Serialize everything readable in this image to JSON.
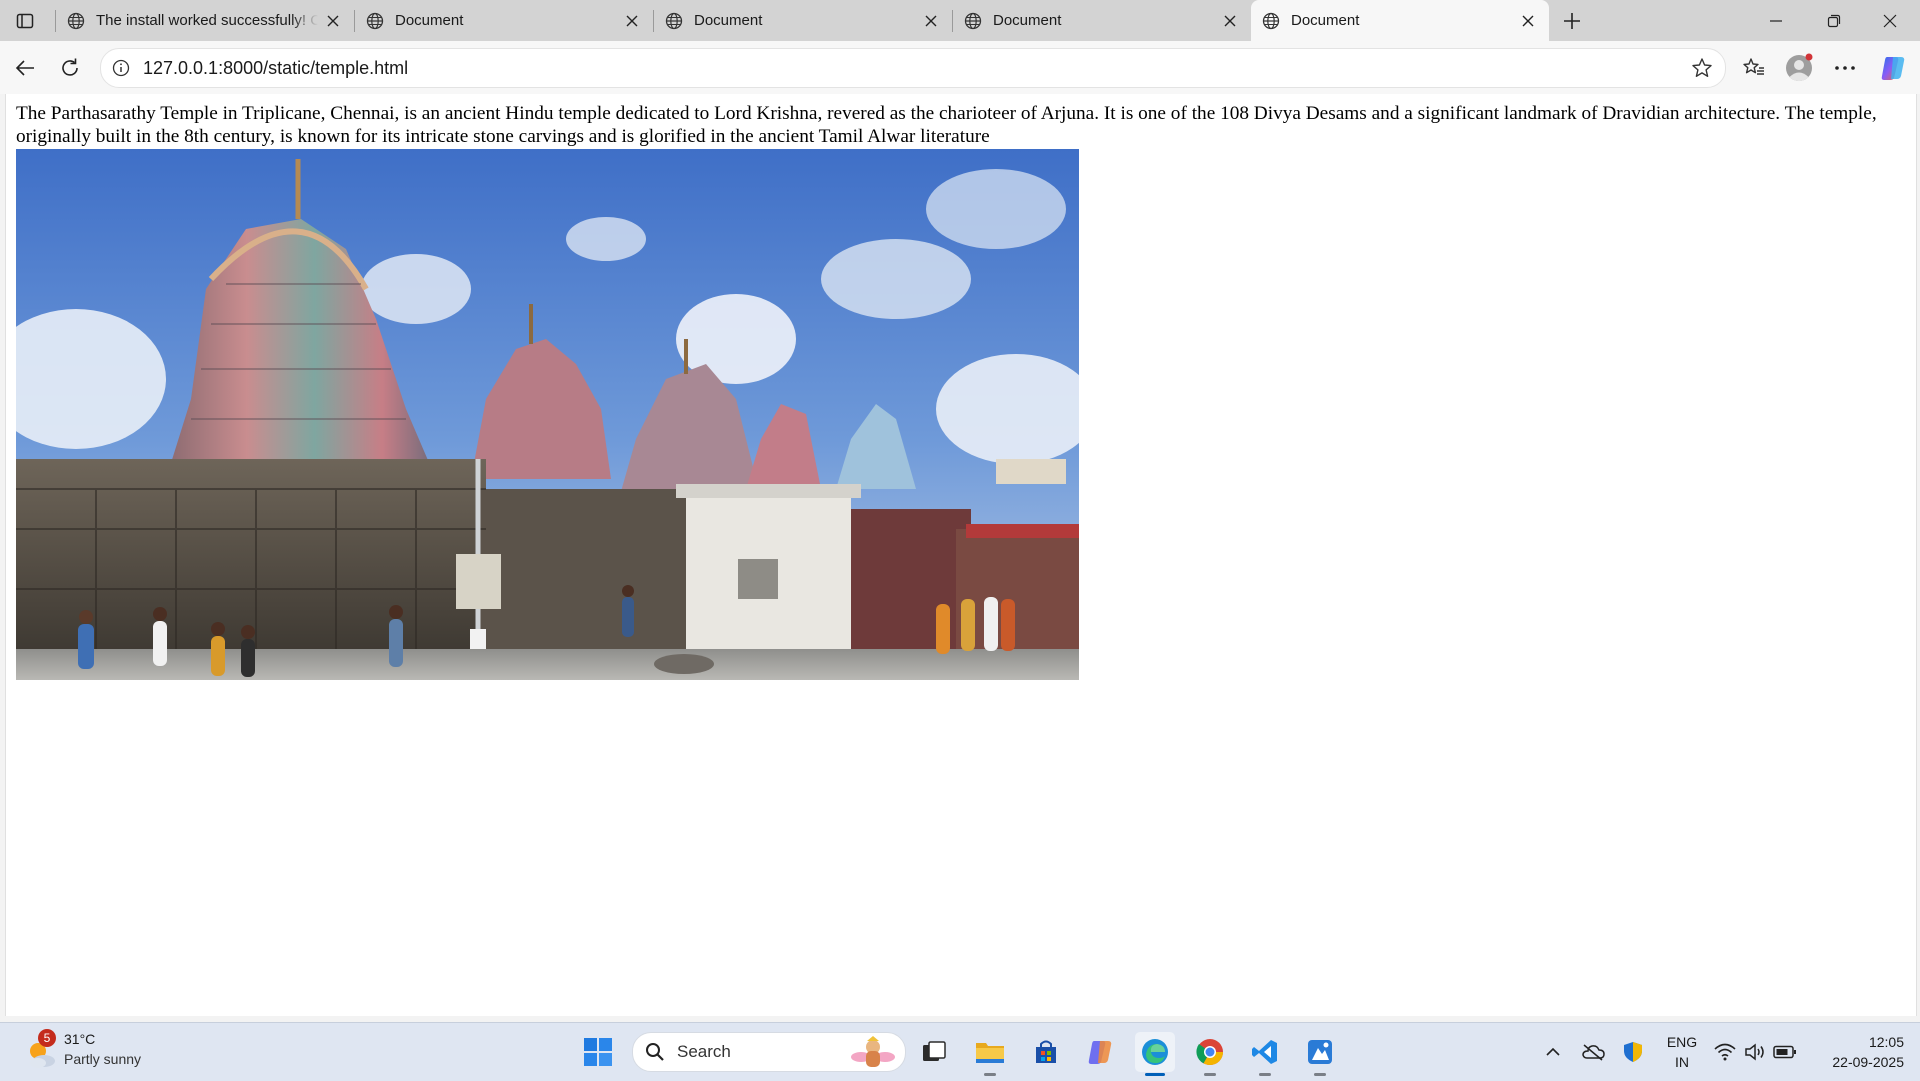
{
  "browser": {
    "tabs": [
      {
        "title": "The install worked successfully! Congratulations!",
        "active": false,
        "icon": "globe-icon"
      },
      {
        "title": "Document",
        "active": false,
        "icon": "globe-icon"
      },
      {
        "title": "Document",
        "active": false,
        "icon": "globe-icon"
      },
      {
        "title": "Document",
        "active": false,
        "icon": "globe-icon"
      },
      {
        "title": "Document",
        "active": true,
        "icon": "globe-icon"
      }
    ],
    "url": "127.0.0.1:8000/static/temple.html"
  },
  "page": {
    "paragraph": "The Parthasarathy Temple in Triplicane, Chennai, is an ancient Hindu temple dedicated to Lord Krishna, revered as the charioteer of Arjuna. It is one of the 108 Divya Desams and a significant landmark of Dravidian architecture. The temple, originally built in the 8th century, is known for its intricate stone carvings and is glorified in the ancient Tamil Alwar literature",
    "image_alt": "temple photo"
  },
  "taskbar": {
    "weather": {
      "temp": "31°C",
      "condition": "Partly sunny",
      "badge": "5"
    },
    "search_label": "Search",
    "language": {
      "line1": "ENG",
      "line2": "IN"
    },
    "clock": {
      "time": "12:05",
      "date": "22-09-2025"
    }
  },
  "colors": {
    "accent": "#005fb8",
    "tabstrip": "#d3d3d3",
    "taskbar": "#dfe6f2"
  }
}
